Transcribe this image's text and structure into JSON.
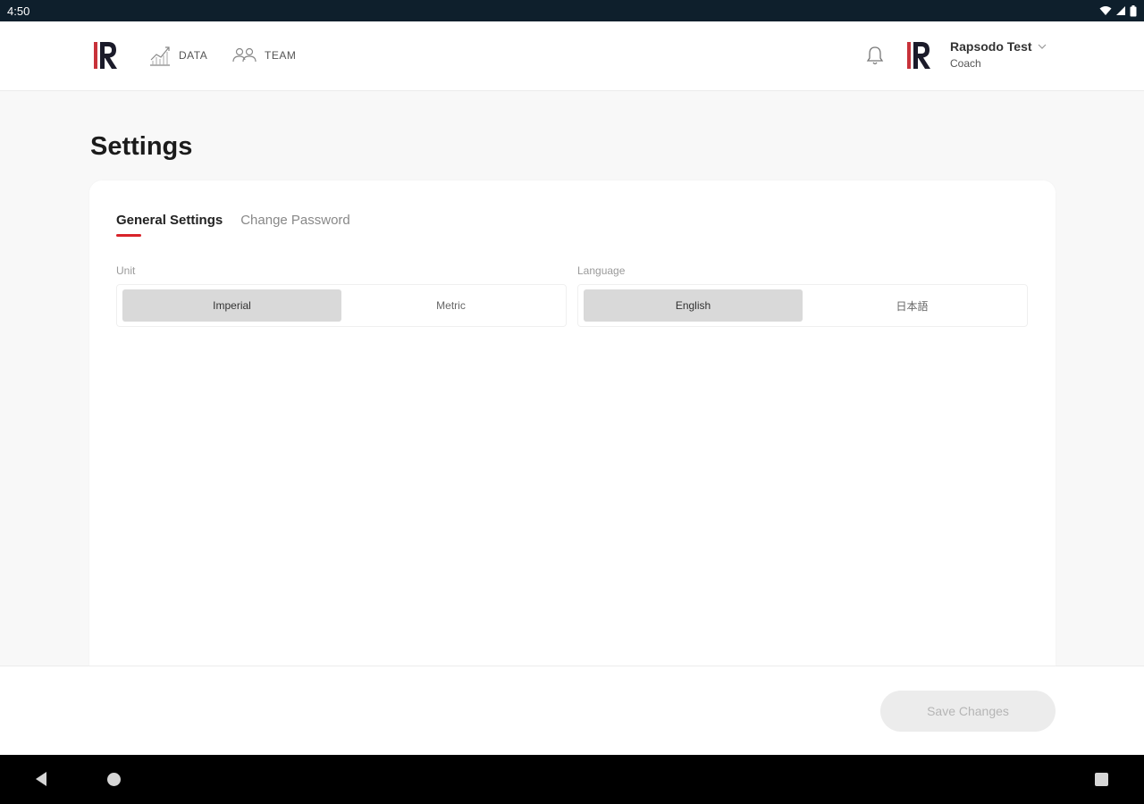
{
  "status_bar": {
    "time": "4:50",
    "icons": [
      "wifi-icon",
      "cell-signal-icon",
      "battery-icon"
    ]
  },
  "header": {
    "logo": "rapsodo-logo",
    "nav": [
      {
        "label": "DATA",
        "icon": "chart-icon"
      },
      {
        "label": "TEAM",
        "icon": "team-icon"
      }
    ],
    "notifications_icon": "bell-icon",
    "user": {
      "name": "Rapsodo Test",
      "role": "Coach"
    }
  },
  "page": {
    "title": "Settings"
  },
  "tabs": [
    {
      "label": "General Settings",
      "active": true
    },
    {
      "label": "Change Password",
      "active": false
    }
  ],
  "general_settings": {
    "unit": {
      "label": "Unit",
      "options": [
        "Imperial",
        "Metric"
      ],
      "selected": "Imperial"
    },
    "language": {
      "label": "Language",
      "options": [
        "English",
        "日本語"
      ],
      "selected": "English"
    }
  },
  "footer": {
    "save_label": "Save Changes"
  },
  "colors": {
    "accent": "#d8232a",
    "status_bar": "#0e1f2c",
    "selected_segment": "#d9d9d9",
    "disabled_button": "#ececec"
  }
}
